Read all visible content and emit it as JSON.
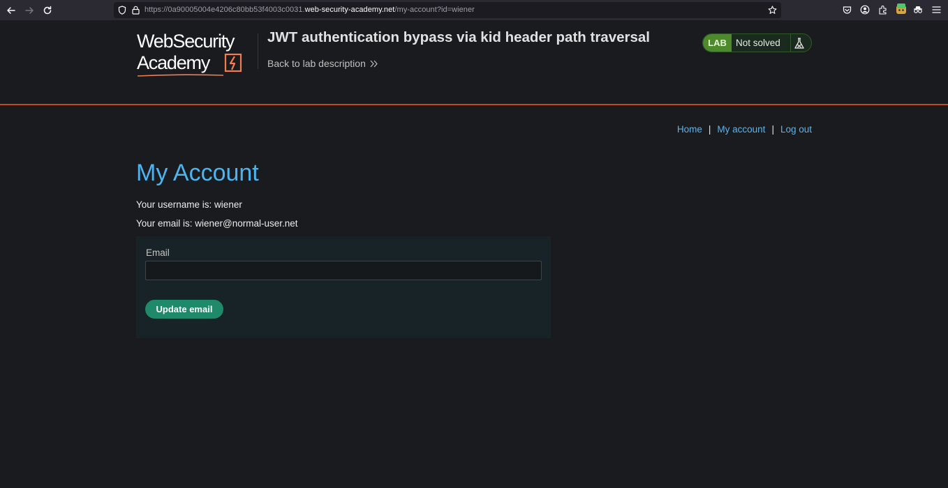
{
  "browser": {
    "url_prefix": "https://0a90005004e4206c80bb53f4003c0031.",
    "url_host": "web-security-academy.net",
    "url_path": "/my-account?id=wiener",
    "icons": [
      "back-arrow-icon",
      "forward-arrow-icon",
      "reload-icon",
      "shield-icon",
      "lock-icon",
      "star-icon",
      "pocket-icon",
      "account-icon",
      "extensions-icon",
      "burp-extension-icon",
      "spy-extension-icon",
      "menu-icon"
    ]
  },
  "header": {
    "logo_line1": "WebSecurity",
    "logo_line2": "Academy",
    "lab_title": "JWT authentication bypass via kid header path traversal",
    "back_link": "Back to lab description",
    "status_badge": "LAB",
    "status_text": "Not solved"
  },
  "nav": {
    "home": "Home",
    "my_account": "My account",
    "log_out": "Log out",
    "separator": "|"
  },
  "main": {
    "title": "My Account",
    "username_line": "Your username is: wiener",
    "email_line": "Your email is: wiener@normal-user.net",
    "form": {
      "email_label": "Email",
      "email_value": "",
      "submit_label": "Update email"
    }
  },
  "colors": {
    "accent_blue": "#4cb4ee",
    "header_rule": "#c6471b",
    "lab_green": "#4d8a2b",
    "button_green": "#1f8a6a",
    "background": "#1a1b1e"
  }
}
